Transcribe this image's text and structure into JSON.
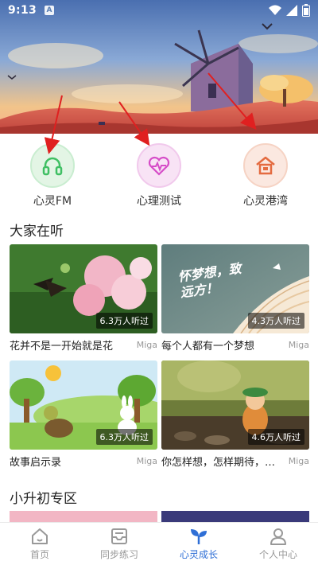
{
  "status_bar": {
    "time": "9:13",
    "notification_letter": "A"
  },
  "quick_links": [
    {
      "label": "心灵FM",
      "icon": "headphones-icon",
      "bg": "#e3f5e5",
      "color": "#3fbf63"
    },
    {
      "label": "心理测试",
      "icon": "heart-pulse-icon",
      "bg": "#f8e3f5",
      "color": "#d64dc8"
    },
    {
      "label": "心灵港湾",
      "icon": "house-icon",
      "bg": "#fbe8e0",
      "color": "#e46b40"
    }
  ],
  "sections": {
    "listening_title": "大家在听",
    "primary_zone_title": "小升初专区"
  },
  "cards": [
    {
      "title": "花并不是一开始就是花",
      "author": "Miga",
      "listeners": "6.3万人听过"
    },
    {
      "title": "每个人都有一个梦想",
      "author": "Miga",
      "listeners": "4.3万人听过",
      "overlay_text": "怀梦想，致远方！"
    },
    {
      "title": "故事启示录",
      "author": "Miga",
      "listeners": "6.3万人听过"
    },
    {
      "title": "你怎样想，怎样期待，就是怎样",
      "author": "Miga",
      "listeners": "4.6万人听过"
    }
  ],
  "bottom_nav": [
    {
      "label": "首页",
      "icon": "home-icon",
      "active": false
    },
    {
      "label": "同步练习",
      "icon": "inbox-icon",
      "active": false
    },
    {
      "label": "心灵成长",
      "icon": "sprout-icon",
      "active": true
    },
    {
      "label": "个人中心",
      "icon": "person-icon",
      "active": false
    }
  ],
  "colors": {
    "accent": "#2f6fd6",
    "annotation_arrow": "#e02020",
    "inactive": "#999999"
  }
}
